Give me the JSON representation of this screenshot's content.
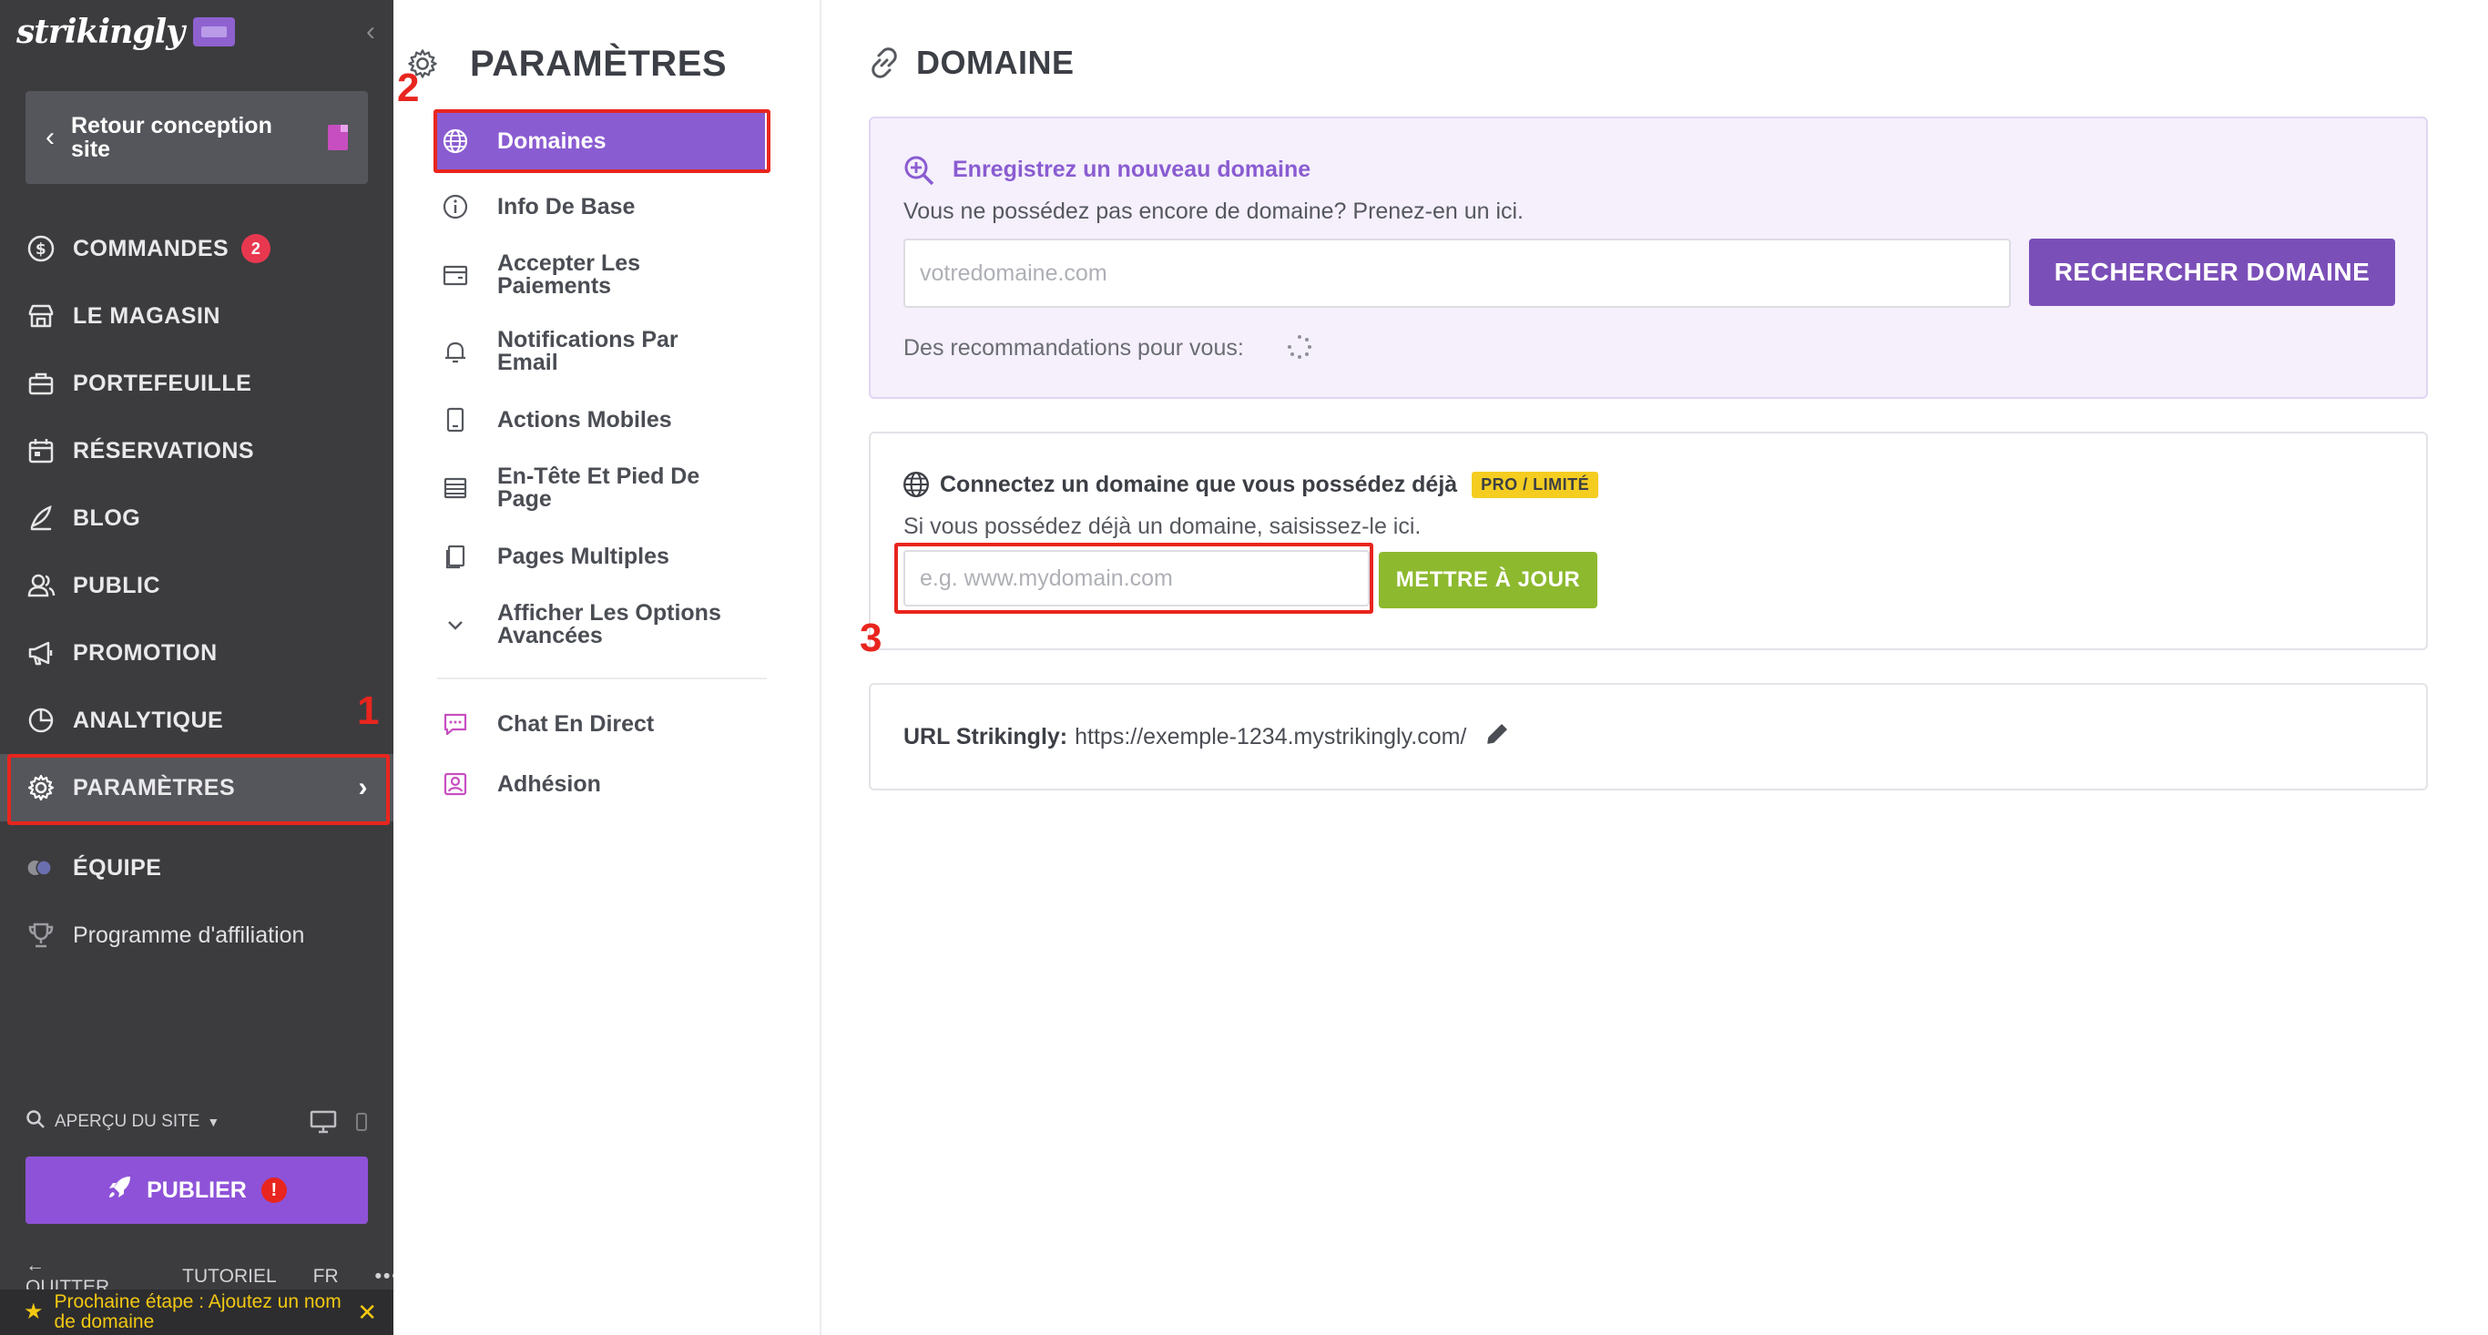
{
  "sidebar": {
    "logo": "strikingly",
    "back_label": "Retour conception site",
    "nav": [
      {
        "label": "COMMANDES",
        "icon": "dollar-icon",
        "badge": "2"
      },
      {
        "label": "LE MAGASIN",
        "icon": "store-icon"
      },
      {
        "label": "PORTEFEUILLE",
        "icon": "briefcase-icon"
      },
      {
        "label": "RÉSERVATIONS",
        "icon": "calendar-icon"
      },
      {
        "label": "BLOG",
        "icon": "pen-icon"
      },
      {
        "label": "PUBLIC",
        "icon": "users-icon"
      },
      {
        "label": "PROMOTION",
        "icon": "megaphone-icon"
      },
      {
        "label": "ANALYTIQUE",
        "icon": "pie-chart-icon"
      },
      {
        "label": "PARAMÈTRES",
        "icon": "gear-icon",
        "active": true
      },
      {
        "label": "ÉQUIPE",
        "icon": "team-avatars-icon"
      },
      {
        "label": "Programme d'affiliation",
        "icon": "trophy-icon"
      }
    ],
    "preview_label": "APERÇU DU SITE",
    "publish_label": "PUBLIER",
    "publish_alert": "!",
    "bottom": {
      "quit": "QUITTER",
      "tutorial": "TUTORIEL",
      "lang": "FR",
      "more": "•••"
    },
    "next_step": "Prochaine étape : Ajoutez un nom de domaine"
  },
  "subnav": {
    "title": "PARAMÈTRES",
    "items": [
      {
        "label": "Domaines",
        "icon": "globe-icon",
        "active": true
      },
      {
        "label": "Info De Base",
        "icon": "info-icon"
      },
      {
        "label": "Accepter Les Paiements",
        "icon": "wallet-icon"
      },
      {
        "label": "Notifications Par Email",
        "icon": "bell-icon"
      },
      {
        "label": "Actions Mobiles",
        "icon": "tablet-icon"
      },
      {
        "label": "En-Tête Et Pied De Page",
        "icon": "layout-icon"
      },
      {
        "label": "Pages Multiples",
        "icon": "pages-icon"
      },
      {
        "label": "Afficher Les Options Avancées",
        "icon": "chevron-down-icon"
      }
    ],
    "extra": [
      {
        "label": "Chat En Direct",
        "icon": "chat-icon"
      },
      {
        "label": "Adhésion",
        "icon": "member-icon"
      }
    ]
  },
  "main": {
    "title": "DOMAINE",
    "register": {
      "heading": "Enregistrez un nouveau domaine",
      "sub": "Vous ne possédez pas encore de domaine? Prenez-en un ici.",
      "placeholder": "votredomaine.com",
      "button": "RECHERCHER DOMAINE",
      "recommend": "Des recommandations pour vous:"
    },
    "connect": {
      "heading": "Connectez un domaine que vous possédez déjà",
      "tag": "PRO / LIMITÉ",
      "sub": "Si vous possédez déjà un domaine, saisissez-le ici.",
      "placeholder": "e.g. www.mydomain.com",
      "button": "METTRE À JOUR"
    },
    "url": {
      "label": "URL Strikingly:",
      "value": "https://exemple-1234.mystrikingly.com/"
    }
  },
  "callouts": {
    "one": "1",
    "two": "2",
    "three": "3"
  },
  "colors": {
    "purple": "#8a5cd1",
    "green": "#8db92e",
    "red": "#e8251e",
    "dark": "#3c3c3f"
  }
}
